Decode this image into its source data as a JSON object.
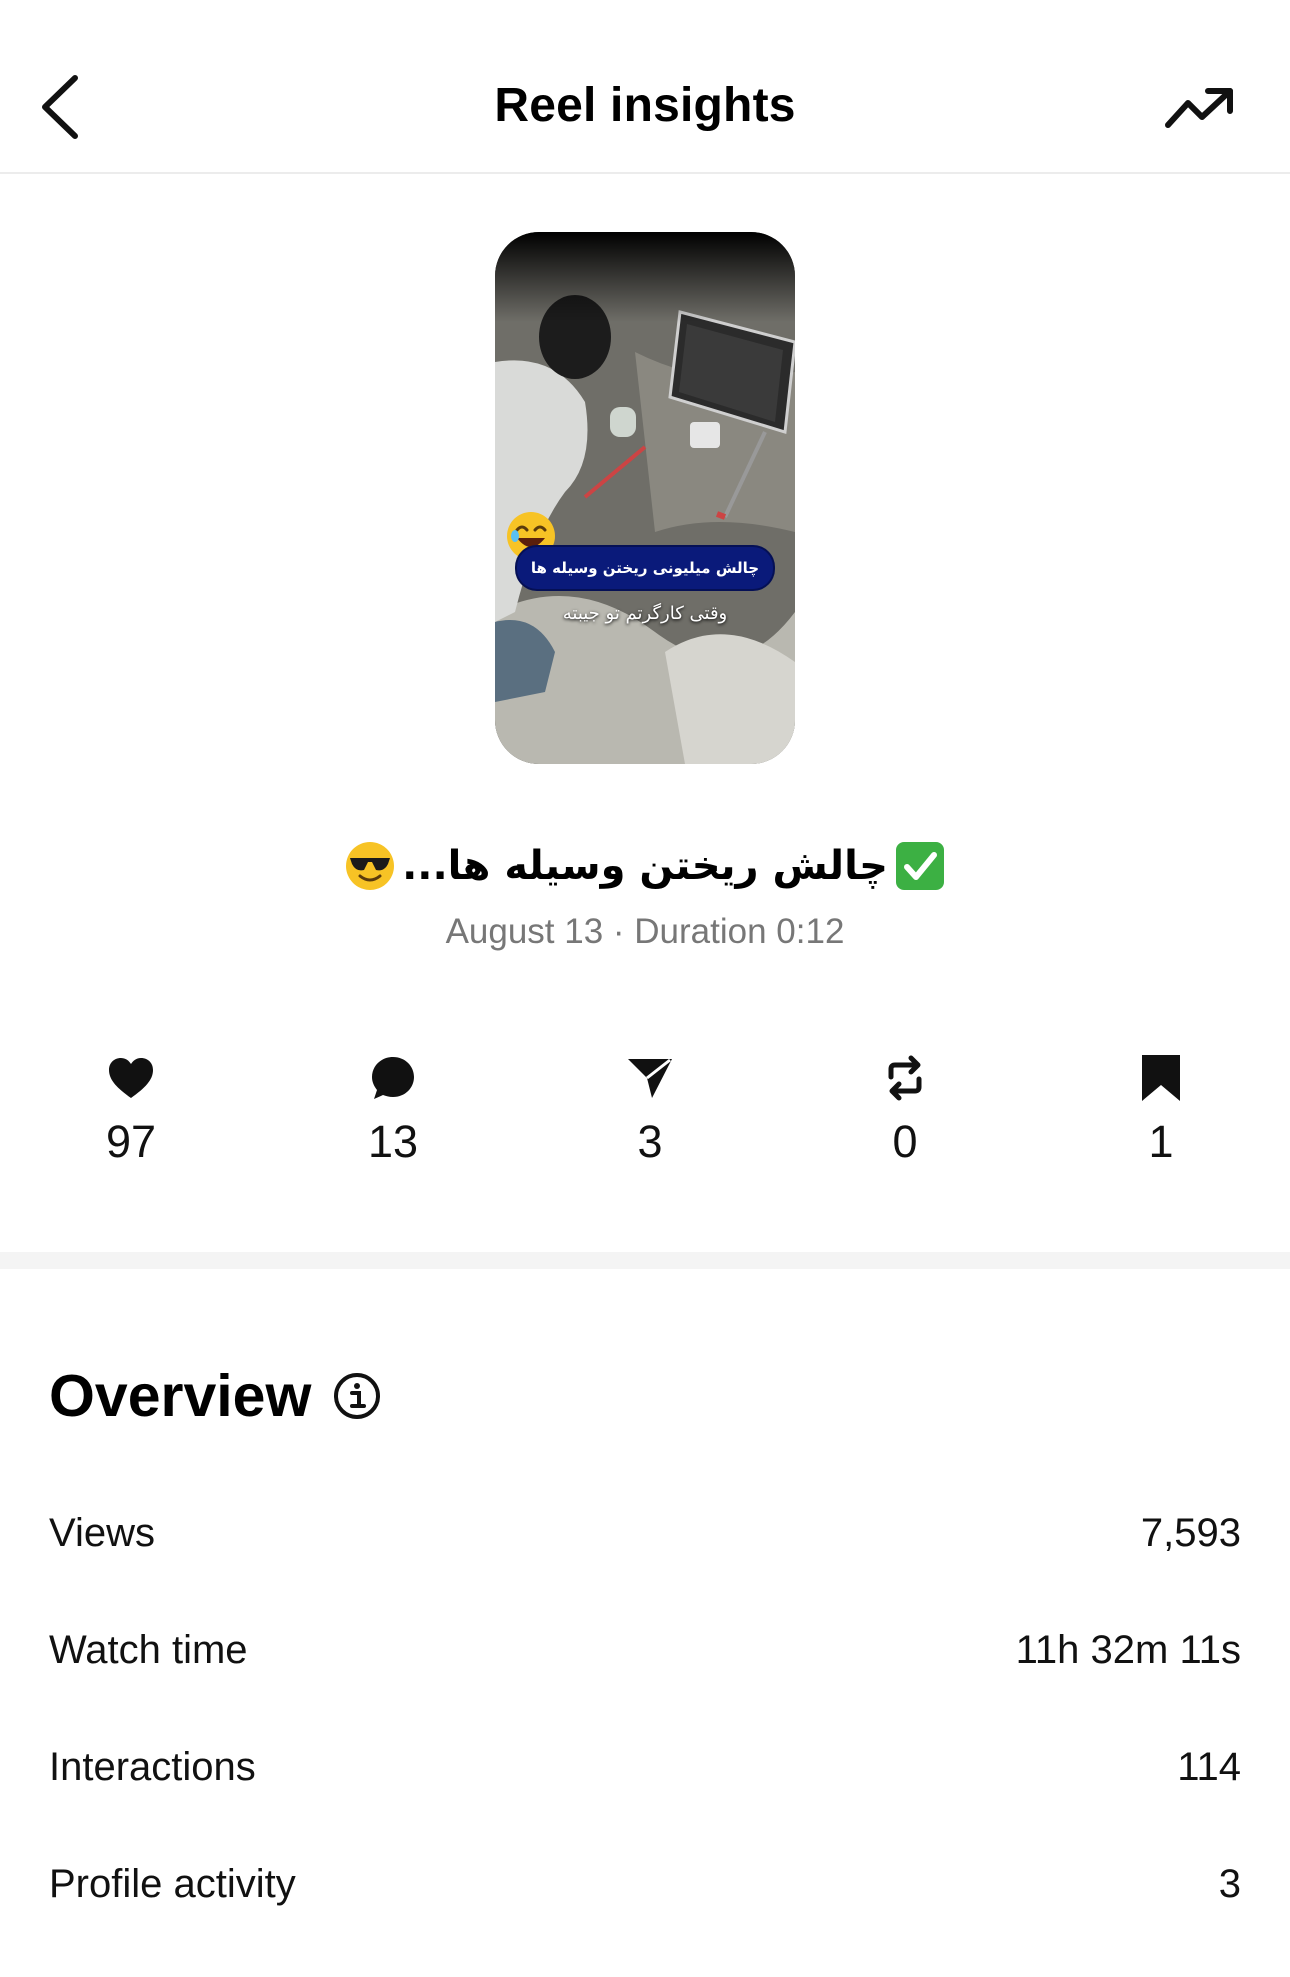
{
  "header": {
    "title": "Reel insights",
    "back_icon": "chevron-left-icon",
    "trend_icon": "trending-up-icon"
  },
  "reel": {
    "thumbnail": {
      "caption_line1": "چالش میلیونی ریختن وسیله ها",
      "caption_line2": "وقتی کارگرتم تو جیبته",
      "emoji": "rolling-on-floor-laughing-emoji"
    },
    "title": "چالش ریختن وسیله ها...",
    "title_leading_emoji": "check-mark-button-emoji",
    "title_trailing_emoji": "smiling-face-with-sunglasses-emoji",
    "meta": "August 13 · Duration 0:12"
  },
  "stats": [
    {
      "icon": "heart-icon",
      "value": "97"
    },
    {
      "icon": "comment-icon",
      "value": "13"
    },
    {
      "icon": "share-icon",
      "value": "3"
    },
    {
      "icon": "repost-icon",
      "value": "0"
    },
    {
      "icon": "bookmark-icon",
      "value": "1"
    }
  ],
  "overview": {
    "title": "Overview",
    "info_icon": "info-icon",
    "metrics": [
      {
        "label": "Views",
        "value": "7,593"
      },
      {
        "label": "Watch time",
        "value": "11h 32m 11s"
      },
      {
        "label": "Interactions",
        "value": "114"
      },
      {
        "label": "Profile activity",
        "value": "3"
      }
    ]
  },
  "colors": {
    "accent_text": "#000000",
    "muted_text": "#777777",
    "caption_pill": "#0a1a7a",
    "check_green": "#3cb043"
  }
}
